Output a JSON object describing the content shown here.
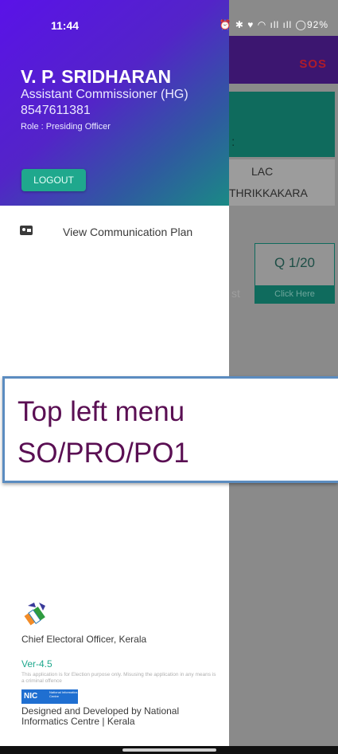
{
  "status_bar": {
    "time": "11:44",
    "icons_text": "⏰ ✱ ♥ ◠ ıll ıll ◯92%"
  },
  "background_app": {
    "sos_label": "SOS",
    "lac_label": "LAC",
    "lac_value": "THRIKKAKARA",
    "question_label": "Q 1/20",
    "question_action": "Click Here",
    "partial_text": "st"
  },
  "drawer": {
    "user": {
      "name": "V. P. SRIDHARAN",
      "designation": "Assistant Commissioner (HG)",
      "phone": "8547611381",
      "role": "Role : Presiding Officer"
    },
    "logout_label": "LOGOUT",
    "menu_items": [
      {
        "icon": "contact-card-icon",
        "label": "View Communication Plan"
      }
    ],
    "footer": {
      "org": "Chief Electoral Officer, Kerala",
      "version": "Ver-4.5",
      "disclaimer": "This application is for Election purpose only. Misusing the application in any means is a criminal offence",
      "nic_logo_text": "NIC",
      "nic_logo_sub": "National Informatics Centre",
      "developer": "Designed and Developed by National Informatics Centre | Kerala"
    }
  },
  "callout": {
    "line1": "Top left  menu",
    "line2": "SO/PRO/PO1"
  },
  "colors": {
    "header_start": "#5a12e8",
    "header_end": "#1a8a85",
    "accent_teal": "#1fa88d",
    "callout_text": "#5a0f53",
    "callout_border": "#5b8cc0"
  }
}
